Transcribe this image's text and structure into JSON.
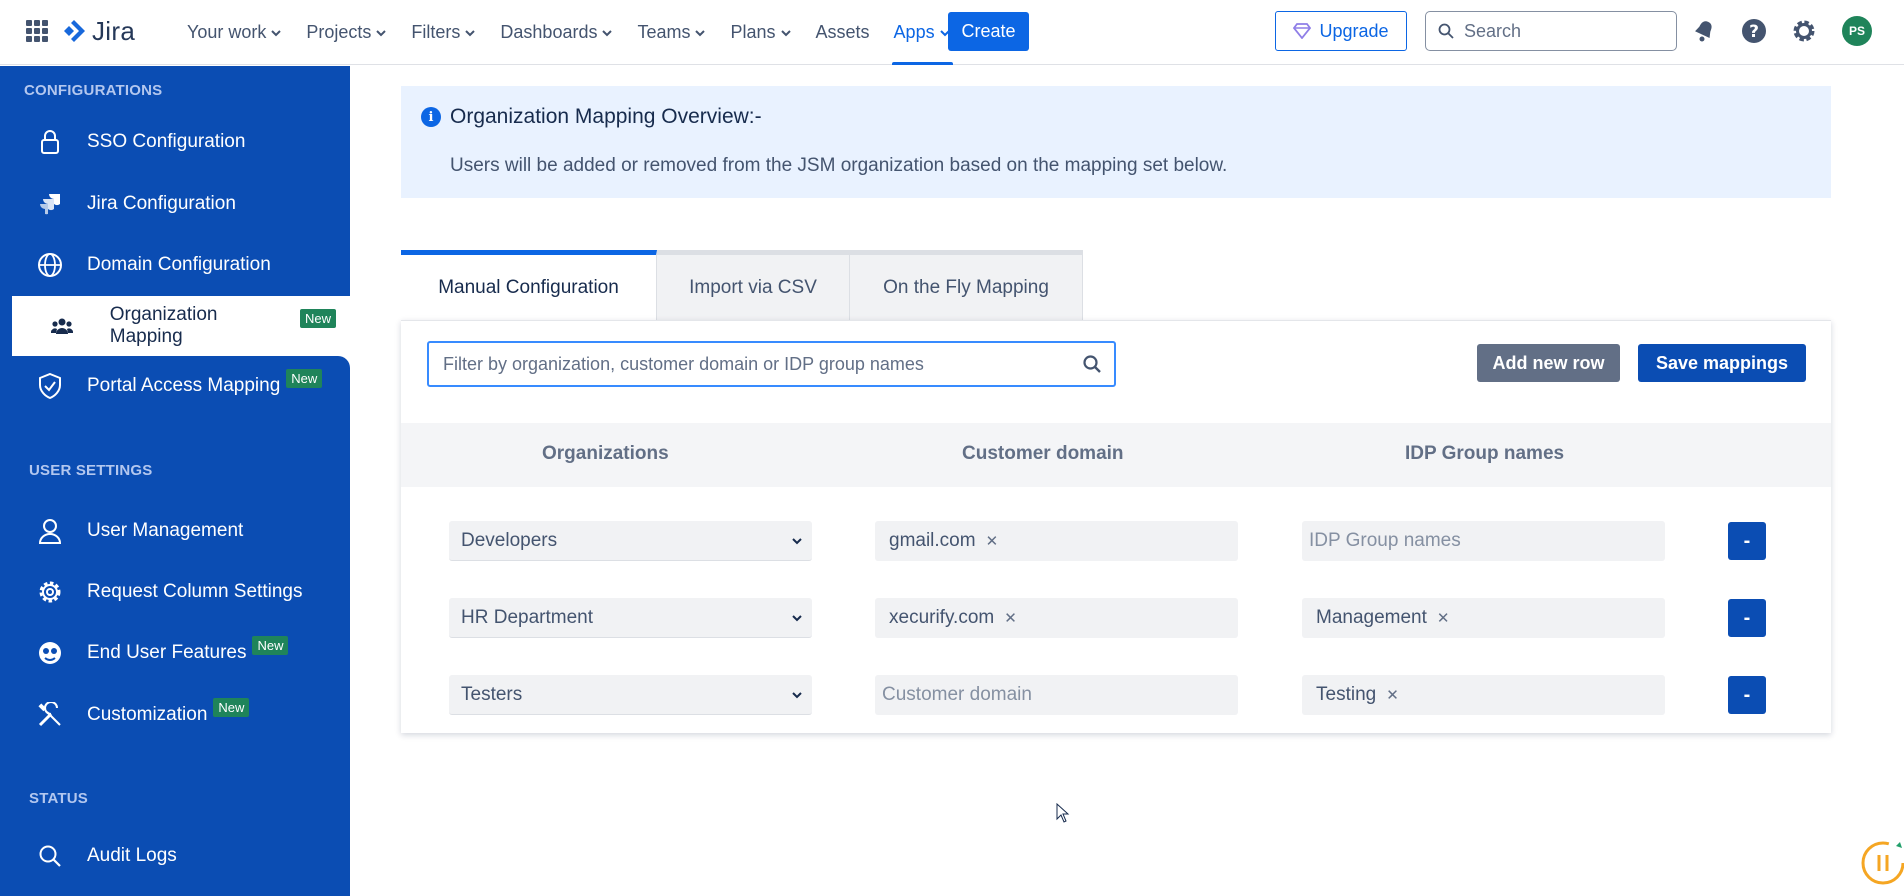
{
  "topnav": {
    "logo_text": "Jira",
    "items": [
      {
        "label": "Your work",
        "dropdown": true
      },
      {
        "label": "Projects",
        "dropdown": true
      },
      {
        "label": "Filters",
        "dropdown": true
      },
      {
        "label": "Dashboards",
        "dropdown": true
      },
      {
        "label": "Teams",
        "dropdown": true
      },
      {
        "label": "Plans",
        "dropdown": true
      },
      {
        "label": "Assets",
        "dropdown": false
      },
      {
        "label": "Apps",
        "dropdown": true,
        "active": true
      }
    ],
    "create_label": "Create",
    "upgrade_label": "Upgrade",
    "search_placeholder": "Search",
    "avatar_initials": "PS"
  },
  "sidebar": {
    "section_config": "CONFIGURATIONS",
    "section_user": "USER SETTINGS",
    "section_status": "STATUS",
    "items": [
      {
        "label": "SSO Configuration",
        "icon": "lock-icon"
      },
      {
        "label": "Jira Configuration",
        "icon": "jira-icon"
      },
      {
        "label": "Domain Configuration",
        "icon": "globe-icon"
      },
      {
        "label": "Organization Mapping",
        "icon": "people-icon",
        "badge": "New",
        "active": true
      },
      {
        "label": "Portal Access Mapping",
        "icon": "shield-icon",
        "badge": "New"
      },
      {
        "label": "User Management",
        "icon": "user-icon"
      },
      {
        "label": "Request Column Settings",
        "icon": "gear-icon"
      },
      {
        "label": "End User Features",
        "icon": "face-icon",
        "badge": "New"
      },
      {
        "label": "Customization",
        "icon": "tools-icon",
        "badge": "New"
      },
      {
        "label": "Audit Logs",
        "icon": "search-icon"
      }
    ]
  },
  "info": {
    "title": "Organization Mapping Overview:-",
    "text": "Users will be added or removed from the JSM organization based on the mapping set below."
  },
  "tabs": [
    {
      "label": "Manual Configuration",
      "active": true
    },
    {
      "label": "Import via CSV",
      "active": false
    },
    {
      "label": "On the Fly Mapping",
      "active": false
    }
  ],
  "toolbar": {
    "filter_placeholder": "Filter by organization, customer domain or IDP group names",
    "add_row_label": "Add new row",
    "save_label": "Save mappings"
  },
  "table": {
    "headers": [
      "Organizations",
      "Customer domain",
      "IDP Group names"
    ],
    "domain_placeholder": "Customer domain",
    "idp_placeholder": "IDP Group names",
    "remove_label": "-",
    "rows": [
      {
        "organization": "Developers",
        "domains": [
          "gmail.com"
        ],
        "groups": []
      },
      {
        "organization": "HR Department",
        "domains": [
          "xecurify.com"
        ],
        "groups": [
          "Management"
        ]
      },
      {
        "organization": "Testers",
        "domains": [],
        "groups": [
          "Testing"
        ]
      }
    ]
  },
  "colors": {
    "sidebar_bg": "#0b4db3",
    "accent": "#0c66e4",
    "badge": "#1f845a",
    "info_bg": "#e9f2ff"
  }
}
